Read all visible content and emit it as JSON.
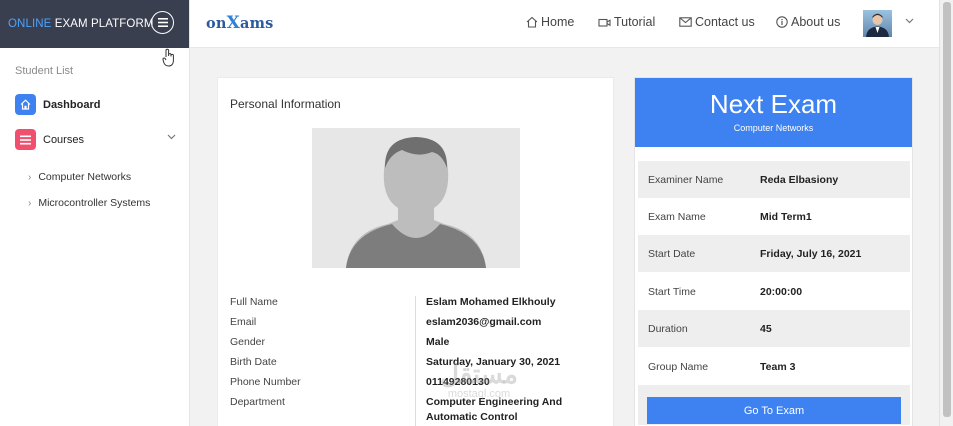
{
  "brand": {
    "accent": "ONLINE",
    "rest": " EXAM PLATFORM"
  },
  "logo": {
    "before": "on",
    "x": "X",
    "after": "ams"
  },
  "sidebar": {
    "section_title": "Student List",
    "items": [
      {
        "label": "Dashboard",
        "icon": "home-icon",
        "color": "#3d82f0"
      },
      {
        "label": "Courses",
        "icon": "list-icon",
        "color": "#f0506e"
      }
    ],
    "courses": [
      "Computer Networks",
      "Microcontroller Systems"
    ]
  },
  "nav": {
    "home": "Home",
    "tutorial": "Tutorial",
    "contact": "Contact us",
    "about": "About us"
  },
  "personal": {
    "title": "Personal Information",
    "fields": [
      {
        "label": "Full Name",
        "value": "Eslam Mohamed Elkhouly"
      },
      {
        "label": "Email",
        "value": "eslam2036@gmail.com"
      },
      {
        "label": "Gender",
        "value": "Male"
      },
      {
        "label": "Birth Date",
        "value": "Saturday, January 30, 2021"
      },
      {
        "label": "Phone Number",
        "value": "01149280130"
      },
      {
        "label": "Department",
        "value": "Computer Engineering And Automatic Control"
      }
    ]
  },
  "exam": {
    "title": "Next Exam",
    "subtitle": "Computer Networks",
    "rows": [
      {
        "label": "Examiner Name",
        "value": "Reda Elbasiony"
      },
      {
        "label": "Exam Name",
        "value": "Mid Term1"
      },
      {
        "label": "Start Date",
        "value": "Friday, July 16, 2021"
      },
      {
        "label": "Start Time",
        "value": "20:00:00"
      },
      {
        "label": "Duration",
        "value": "45"
      },
      {
        "label": "Group Name",
        "value": "Team 3"
      }
    ],
    "button": "Go To Exam"
  },
  "watermark": {
    "main": "مستقل",
    "sub": "mostaql.com"
  },
  "colors": {
    "primary": "#3d82f0",
    "sidebar_header": "#3a3f4f",
    "brand_accent": "#4aa3ff",
    "courses_icon": "#f0506e"
  }
}
